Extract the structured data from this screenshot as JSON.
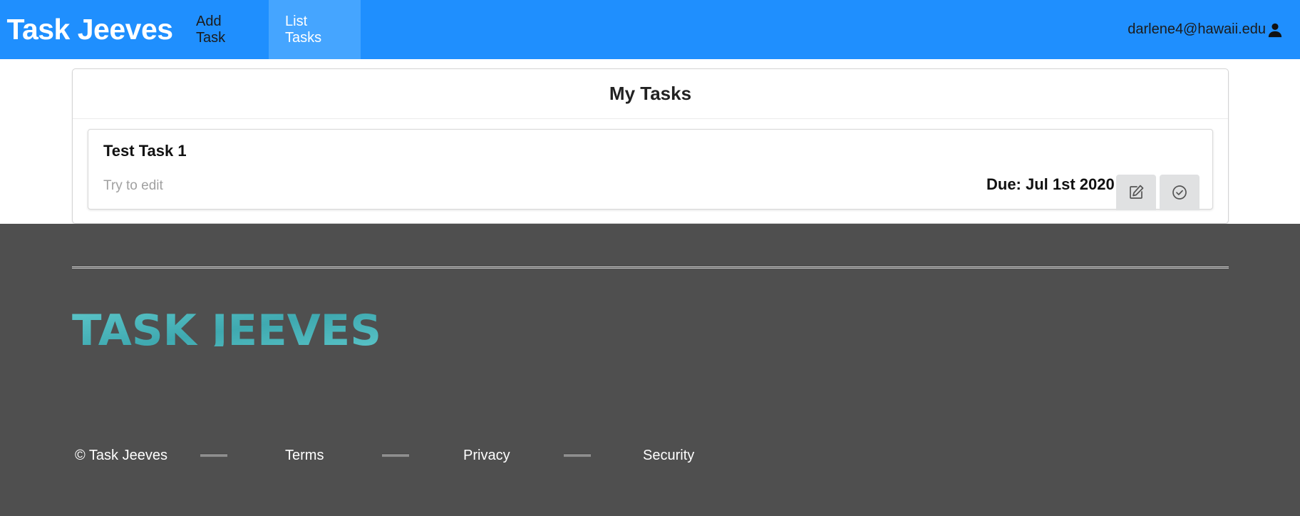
{
  "navbar": {
    "brand": "Task Jeeves",
    "items": [
      {
        "label": "Add Task"
      },
      {
        "label": "List Tasks",
        "active": true
      }
    ],
    "user_email": "darlene4@hawaii.edu",
    "user_icon": "user-icon",
    "colors": {
      "background": "#1f8ffe",
      "active": "#45a5ff"
    }
  },
  "main": {
    "title": "My Tasks",
    "tasks": [
      {
        "title": "Test Task 1",
        "description": "Try to edit",
        "due": "Due: Jul 1st 2020",
        "actions": [
          {
            "icon": "edit-icon"
          },
          {
            "icon": "check-circle-icon"
          }
        ]
      }
    ]
  },
  "footer": {
    "logo_text": "TASK JEEVES",
    "logo_color": "#59c2c6",
    "copyright": "© Task Jeeves",
    "links": [
      "Terms",
      "Privacy",
      "Security"
    ],
    "background": "#4f4f4f"
  }
}
